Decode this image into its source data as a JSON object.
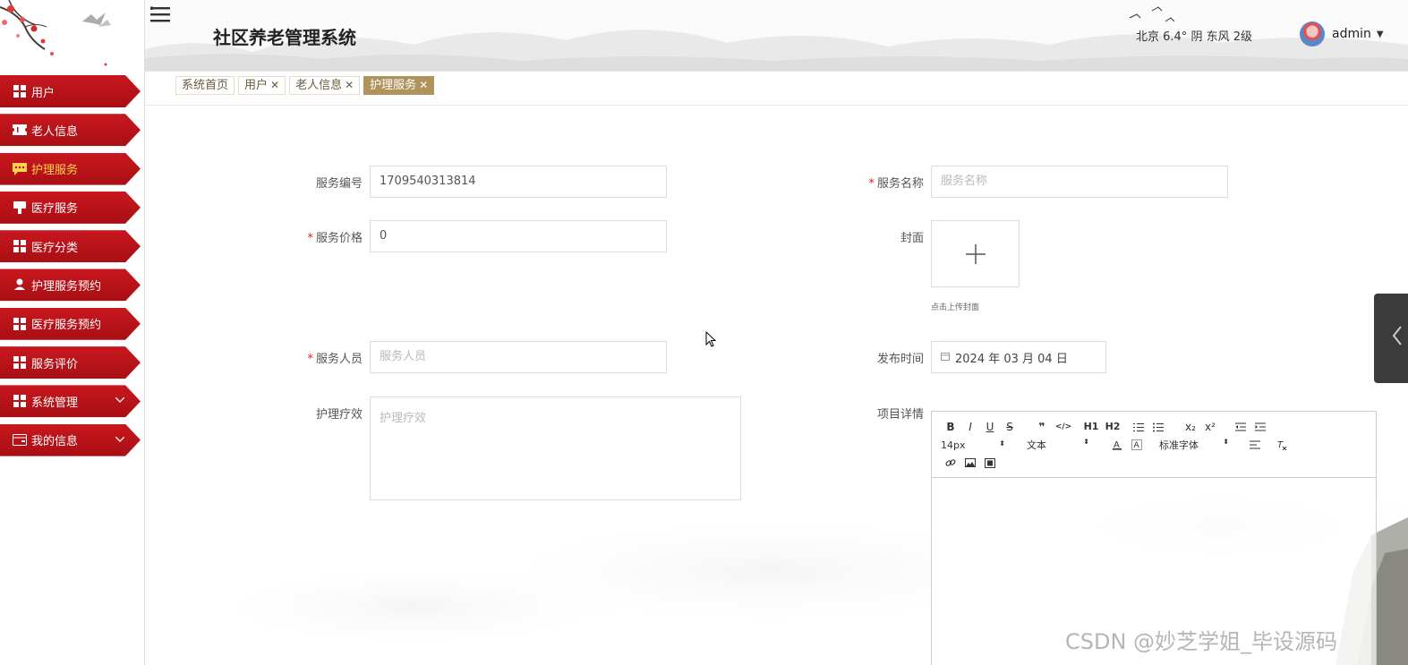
{
  "header": {
    "title": "社区养老管理系统",
    "weather": "北京 6.4° 阴 东风 2级",
    "user": "admin"
  },
  "sidebar": {
    "items": [
      {
        "label": "用户",
        "icon": "grid-icon"
      },
      {
        "label": "老人信息",
        "icon": "ticket-icon"
      },
      {
        "label": "护理服务",
        "icon": "chat-icon",
        "active": true
      },
      {
        "label": "医疗服务",
        "icon": "stamp-icon"
      },
      {
        "label": "医疗分类",
        "icon": "grid-icon"
      },
      {
        "label": "护理服务预约",
        "icon": "person-icon"
      },
      {
        "label": "医疗服务预约",
        "icon": "grid-icon"
      },
      {
        "label": "服务评价",
        "icon": "grid-icon"
      },
      {
        "label": "系统管理",
        "icon": "grid-icon",
        "expandable": true
      },
      {
        "label": "我的信息",
        "icon": "card-icon",
        "expandable": true
      }
    ]
  },
  "tabs": [
    {
      "label": "系统首页"
    },
    {
      "label": "用户",
      "closable": true
    },
    {
      "label": "老人信息",
      "closable": true
    },
    {
      "label": "护理服务",
      "closable": true,
      "active": true
    }
  ],
  "form": {
    "service_no": {
      "label": "服务编号",
      "value": "1709540313814"
    },
    "service_name": {
      "label": "服务名称",
      "placeholder": "服务名称",
      "required": true
    },
    "price": {
      "label": "服务价格",
      "value": "0",
      "required": true
    },
    "cover": {
      "label": "封面",
      "tip": "点击上传封面"
    },
    "staff": {
      "label": "服务人员",
      "placeholder": "服务人员",
      "required": true
    },
    "publish_time": {
      "label": "发布时间",
      "value": "2024 年 03 月 04 日"
    },
    "effect": {
      "label": "护理疗效",
      "placeholder": "护理疗效"
    },
    "details": {
      "label": "项目详情"
    }
  },
  "editor": {
    "row1": [
      "B",
      "I",
      "U",
      "S",
      "❞",
      "</>",
      "H1",
      "H2",
      "ol",
      "ul",
      "x₂",
      "x²",
      "outdent",
      "indent"
    ],
    "font_size": "14px",
    "header_select": "文本",
    "font_family": "标准字体",
    "row3": [
      "link",
      "image",
      "video"
    ]
  },
  "watermark": "CSDN @妙芝学姐_毕设源码",
  "colors": {
    "menu_red": "#c9171e",
    "active_text": "#ffd34d",
    "active_tab": "#b0935c",
    "required": "#e02020"
  }
}
